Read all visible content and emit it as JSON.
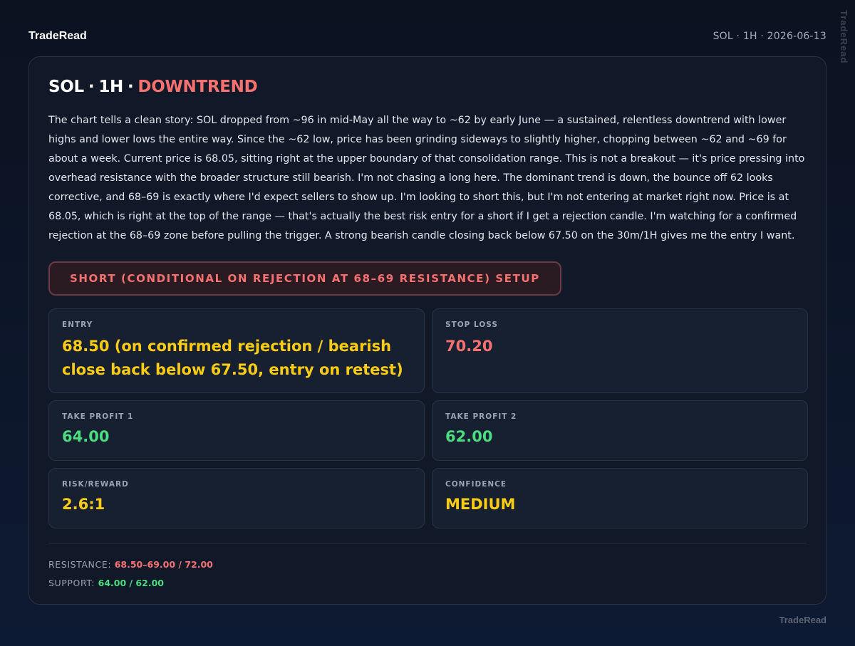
{
  "header": {
    "brand": "TradeRead",
    "meta": "SOL · 1H · 2026-06-13",
    "side_watermark": "TradeRead"
  },
  "card": {
    "title": {
      "symbol": "SOL",
      "timeframe": "1H",
      "separator": "·",
      "trend": "DOWNTREND"
    },
    "analysis": "The chart tells a clean story: SOL dropped from ~96 in mid-May all the way to ~62 by early June — a sustained, relentless downtrend with lower highs and lower lows the entire way. Since the ~62 low, price has been grinding sideways to slightly higher, chopping between ~62 and ~69 for about a week. Current price is 68.05, sitting right at the upper boundary of that consolidation range. This is not a breakout — it's price pressing into overhead resistance with the broader structure still bearish. I'm not chasing a long here. The dominant trend is down, the bounce off 62 looks corrective, and 68–69 is exactly where I'd expect sellers to show up. I'm looking to short this, but I'm not entering at market right now. Price is at 68.05, which is right at the top of the range — that's actually the best risk entry for a short if I get a rejection candle. I'm watching for a confirmed rejection at the 68–69 zone before pulling the trigger. A strong bearish candle closing back below 67.50 on the 30m/1H gives me the entry I want.",
    "setup_label": "SHORT (CONDITIONAL ON REJECTION AT 68–69 RESISTANCE) SETUP",
    "stats": {
      "entry": {
        "label": "ENTRY",
        "value": "68.50 (on confirmed rejection / bearish close back below 67.50, entry on retest)"
      },
      "stop_loss": {
        "label": "STOP LOSS",
        "value": "70.20"
      },
      "take_profit_1": {
        "label": "TAKE PROFIT 1",
        "value": "64.00"
      },
      "take_profit_2": {
        "label": "TAKE PROFIT 2",
        "value": "62.00"
      },
      "risk_reward": {
        "label": "RISK/REWARD",
        "value": "2.6:1"
      },
      "confidence": {
        "label": "CONFIDENCE",
        "value": "MEDIUM"
      }
    },
    "levels": {
      "resistance_label": "RESISTANCE:",
      "resistance_value": "68.50–69.00 / 72.00",
      "support_label": "SUPPORT:",
      "support_value": "64.00 / 62.00"
    }
  },
  "footer": {
    "brand": "TradeRead"
  },
  "colors": {
    "background": "#0b1220",
    "card": "#111827",
    "bearish": "#f87171",
    "bullish": "#4ade80",
    "neutral_highlight": "#facc15"
  }
}
